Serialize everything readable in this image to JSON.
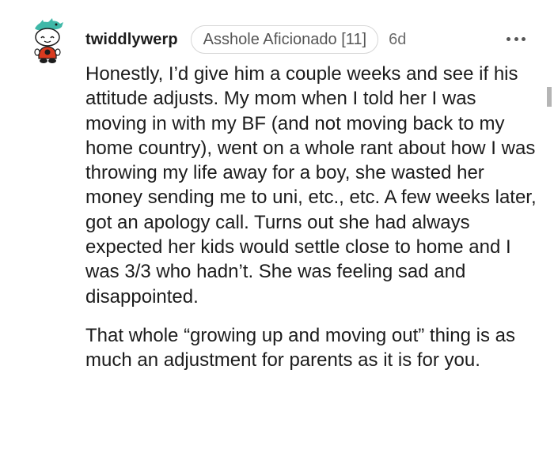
{
  "comment": {
    "avatar_icon": "snoo-avatar-icon",
    "username": "twiddlywerp",
    "flair": "Asshole Aficionado [11]",
    "timestamp": "6d",
    "more_icon": "more-options-icon",
    "paragraphs": [
      "Honestly, I’d give him a couple weeks and see if his attitude adjusts. My mom when I told her I was moving in with my BF (and not moving back to my home country), went on a whole rant about how I was throwing my life away for a boy, she wasted her money sending me to uni, etc., etc. A few weeks later, got an apology call. Turns out she had always expected her kids would settle close to home and I was 3/3 who hadn’t. She was feeling sad and disappointed.",
      "That whole “growing up and moving out” thing is as much an adjustment for parents as it is for you."
    ]
  },
  "colors": {
    "text": "#1c1c1c",
    "meta": "#6b6b6b",
    "flair_border": "#d6d6d6",
    "avatar_hat": "#3fb8a8",
    "avatar_shirt": "#d93a1f"
  }
}
